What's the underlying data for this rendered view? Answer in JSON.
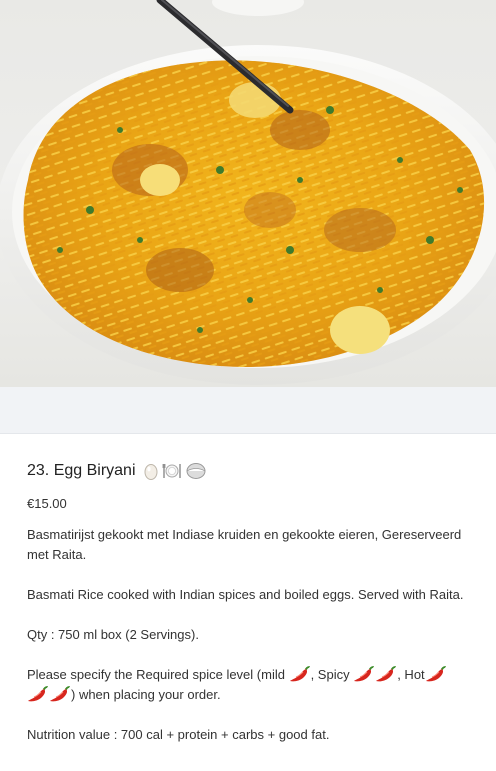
{
  "product": {
    "title": "23. Egg Biryani",
    "title_icons": [
      "egg-icon",
      "plate-cutlery-icon",
      "takeaway-container-icon"
    ],
    "price": "€15.00",
    "description_nl": "Basmatirijst gekookt met Indiase kruiden en gekookte eieren, Gereserveerd met Raita.",
    "description_en": "Basmati Rice cooked with Indian spices and boiled eggs. Served with Raita.",
    "quantity": "Qty : 750 ml box (2 Servings).",
    "spice": {
      "prefix": "Please specify the Required spice level (mild ",
      "spicy": ", Spicy ",
      "hot": ", Hot",
      "suffix": ") when placing your order.",
      "chili_icon": "chili-pepper-icon",
      "mild_count": 1,
      "spicy_count": 2,
      "hot_count": 3
    },
    "nutrition": "Nutrition value : 700 cal + protein + carbs + good fat."
  },
  "colors": {
    "band": "#f1f3f6",
    "text": "#333333",
    "chili": "#d7261e"
  }
}
